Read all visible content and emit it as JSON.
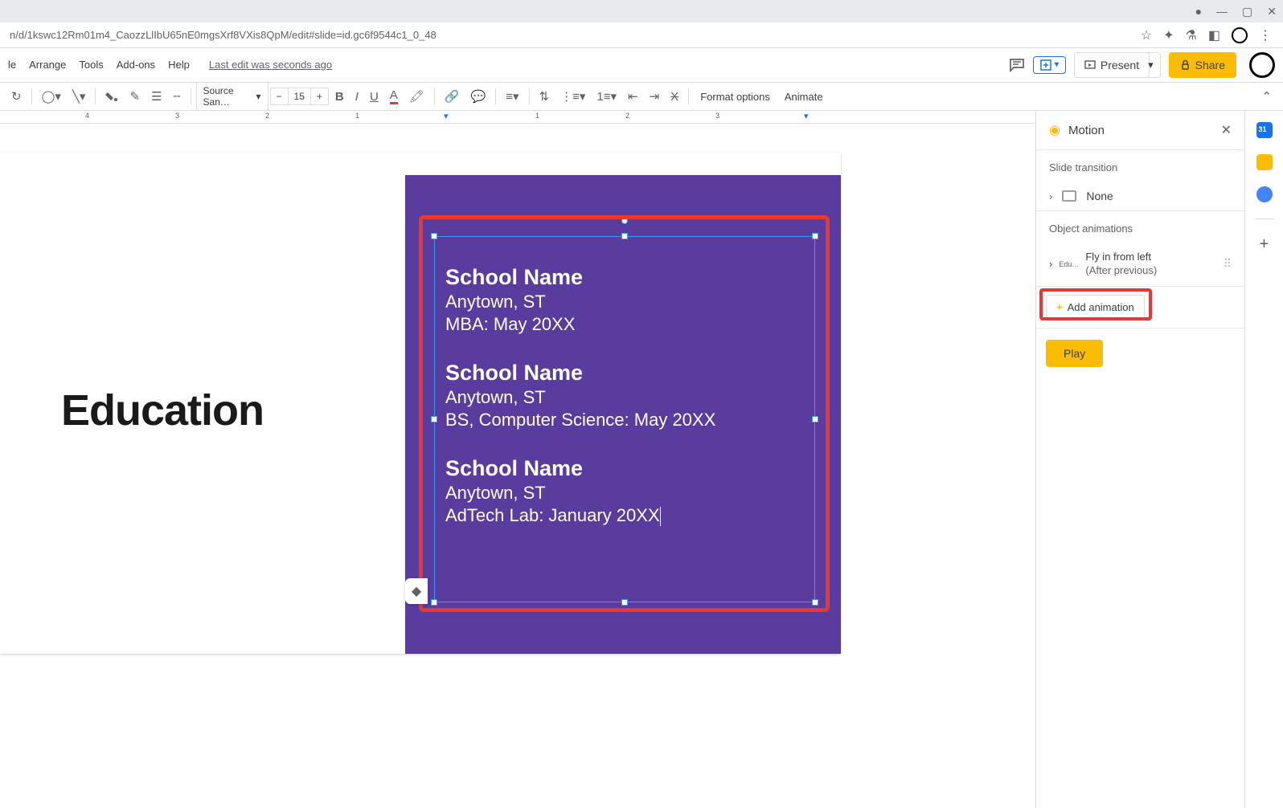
{
  "window": {
    "url": "n/d/1kswc12Rm01m4_CaozzLlIbU65nE0mgsXrf8VXis8QpM/edit#slide=id.gc6f9544c1_0_48"
  },
  "menubar": {
    "items": [
      "le",
      "Arrange",
      "Tools",
      "Add-ons",
      "Help"
    ],
    "last_edit": "Last edit was seconds ago",
    "present": "Present",
    "share": "Share"
  },
  "toolbar": {
    "font": "Source San…",
    "font_size": "15",
    "format_options": "Format options",
    "animate": "Animate"
  },
  "ruler": {
    "marks": [
      "4",
      "3",
      "2",
      "1",
      "1",
      "2",
      "3"
    ]
  },
  "slide": {
    "title": "Education",
    "entries": [
      {
        "name": "School Name",
        "location": "Anytown, ST",
        "degree": "MBA: May 20XX"
      },
      {
        "name": "School Name",
        "location": "Anytown, ST",
        "degree": "BS, Computer Science: May 20XX"
      },
      {
        "name": "School Name",
        "location": "Anytown, ST",
        "degree": "AdTech Lab: January 20XX"
      }
    ]
  },
  "motion": {
    "title": "Motion",
    "slide_transition_label": "Slide transition",
    "transition_value": "None",
    "object_animations_label": "Object animations",
    "animation": {
      "target": "Edu…",
      "effect": "Fly in from left",
      "timing": "(After previous)"
    },
    "add_animation": "Add animation",
    "play": "Play"
  }
}
